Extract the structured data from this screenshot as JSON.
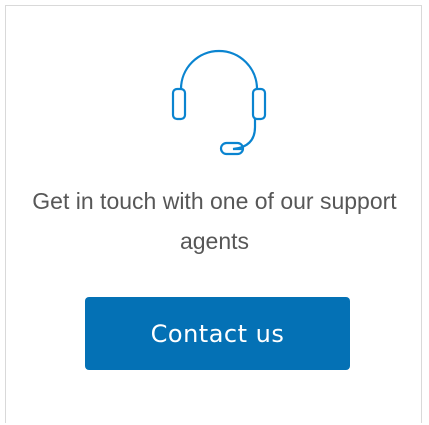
{
  "support_card": {
    "icon": "headset-icon",
    "headline": "Get in touch with one of our support agents",
    "cta_label": "Contact us"
  },
  "colors": {
    "accent": "#0471b5",
    "icon": "#0a84d0",
    "text": "#575757",
    "border": "#d9d9d9"
  }
}
